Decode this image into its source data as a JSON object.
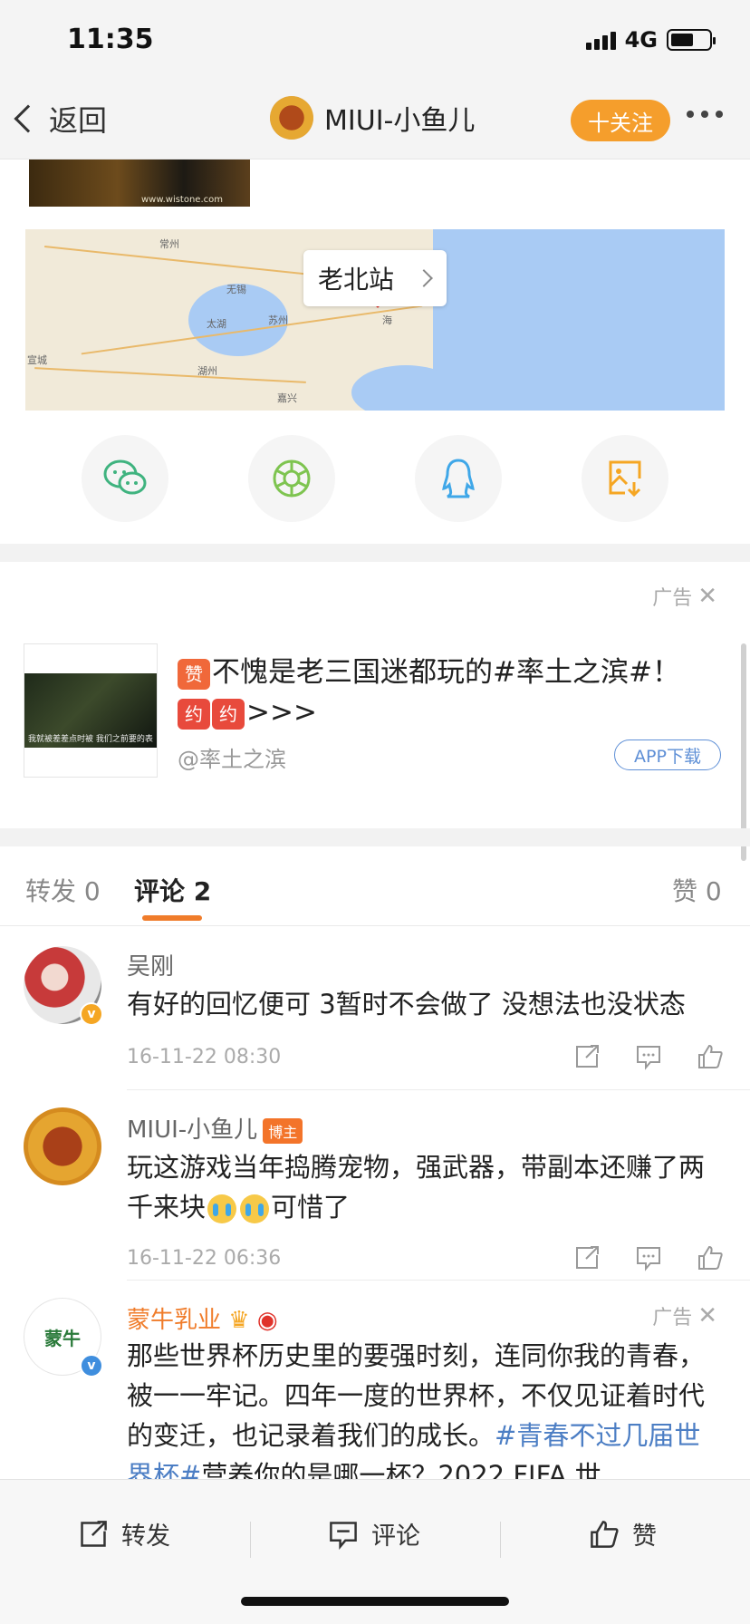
{
  "status_bar": {
    "time": "11:35",
    "network": "4G"
  },
  "nav": {
    "back_label": "返回",
    "title": "MIUI-小鱼儿",
    "follow_label": "十关注"
  },
  "game_image_caption": "www.wistone.com",
  "map": {
    "location_label": "老北站",
    "place_labels": [
      "常州",
      "无锡",
      "太湖",
      "苏州",
      "湖州",
      "嘉兴",
      "宣城",
      "海"
    ]
  },
  "share_icons": [
    "wechat-icon",
    "moments-icon",
    "qq-icon",
    "save-image-icon"
  ],
  "ad1": {
    "label": "广告",
    "badge_zan": "赞",
    "title_part1": "不愧是老三国迷都玩的#率土之滨#！",
    "badge_tuo": "约",
    "title_part2": ">>>",
    "handle": "@率土之滨",
    "download_label": "APP下载",
    "thumb_caption": "我就被差差点时被 我们之前要的表"
  },
  "tabs": {
    "repost": "转发",
    "repost_count": "0",
    "comment": "评论",
    "comment_count": "2",
    "like": "赞",
    "like_count": "0"
  },
  "comments": [
    {
      "name": "吴刚",
      "text": "有好的回忆便可 3暂时不会做了 没想法也没状态",
      "time": "16-11-22 08:30"
    },
    {
      "name": "MIUI-小鱼儿",
      "badge": "博主",
      "text_part1": "玩这游戏当年捣腾宠物，强武器，带副本还赚了两千来块",
      "text_part2": "可惜了",
      "time": "16-11-22 06:36"
    }
  ],
  "ad2": {
    "name": "蒙牛乳业",
    "label": "广告",
    "avatar_text": "蒙牛",
    "text_part1": "那些世界杯历史里的要强时刻，连同你我的青春，被一一牢记。四年一度的世界杯，不仅见证着时代的变迁，也记录着我们的成长。",
    "hashtag": "#青春不过几届世界杯#",
    "text_part2": "营养你的是哪一杯？2022 FIFA 世"
  },
  "bottom_bar": {
    "repost": "转发",
    "comment": "评论",
    "like": "赞"
  },
  "colors": {
    "accent_orange": "#f59e2c",
    "tab_underline": "#f07c2a",
    "link_blue": "#4c7ec4",
    "verified_blue": "#3f8ede",
    "verified_gold": "#f5a623"
  }
}
